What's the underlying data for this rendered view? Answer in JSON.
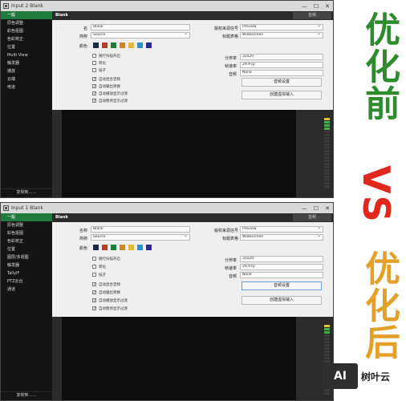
{
  "panels": [
    {
      "title": "Input 2 Blank",
      "header_label": "Blank",
      "header_button": "音频",
      "sidebar": [
        "一般",
        "原色调整",
        "彩色抠图",
        "色彩校正",
        "位置",
        "Multi View",
        "触发器",
        "播放",
        "云端",
        "电道"
      ],
      "footer": "复制到……",
      "labels": {
        "name": "名",
        "short": "简称",
        "color": "颜色",
        "src_label": "版权来源信号",
        "title_label": "标题表格",
        "res": "分辨率",
        "fps": "帧速率",
        "audio": "音频"
      },
      "values": {
        "name": "Blank",
        "short": "Source",
        "src": "Preview",
        "title": "Widescreen",
        "res": "32x20",
        "fps": "29.97p",
        "audio": "None"
      },
      "checks": [
        {
          "label": "随行扫描开启",
          "checked": false
        },
        {
          "label": "转化",
          "checked": false
        },
        {
          "label": "描子",
          "checked": false
        },
        {
          "label": "自动混合音频",
          "checked": true
        },
        {
          "label": "自动输出转换",
          "checked": true
        },
        {
          "label": "自动播放显示过渡",
          "checked": true
        },
        {
          "label": "自动暂停显示过渡",
          "checked": true
        }
      ],
      "buttons": [
        "音频设置",
        "创建虚拟输入"
      ]
    },
    {
      "title": "Input 1 Blank",
      "header_label": "Blank",
      "header_button": "音频",
      "sidebar": [
        "一般",
        "原色调整",
        "彩色抠图",
        "色彩校正",
        "位置",
        "图层/多视图",
        "触发器",
        "TallyIF",
        "PTZ云台",
        "通道"
      ],
      "footer": "复制到……",
      "labels": {
        "name": "名称",
        "short": "简称",
        "color": "颜色",
        "src_label": "版权来源信号",
        "title_label": "标题表格",
        "res": "分辨率",
        "fps": "帧速率",
        "audio": "音频"
      },
      "values": {
        "name": "Blank",
        "short": "Source",
        "src": "Preview",
        "title": "Widescreen",
        "res": "32x20",
        "fps": "29.97p",
        "audio": "None"
      },
      "checks": [
        {
          "label": "随行扫描开启",
          "checked": false
        },
        {
          "label": "转化",
          "checked": false
        },
        {
          "label": "描子",
          "checked": false
        },
        {
          "label": "自动混合音频",
          "checked": true
        },
        {
          "label": "自动输出转换",
          "checked": true
        },
        {
          "label": "自动播放显示过渡",
          "checked": true
        },
        {
          "label": "自动暂停显示过渡",
          "checked": true
        }
      ],
      "buttons": [
        "音频设置",
        "创建虚拟输入"
      ]
    }
  ],
  "swatch_colors": [
    "#1c2a44",
    "#c0392b",
    "#1f7a3c",
    "#cf8a1f",
    "#e2b93b",
    "#2b8fd8",
    "#2d2a8c"
  ],
  "side": {
    "before": "优化前",
    "vs": "VS",
    "after": "优化后"
  },
  "watermark": {
    "logo": "AI",
    "text": "树叶云"
  }
}
